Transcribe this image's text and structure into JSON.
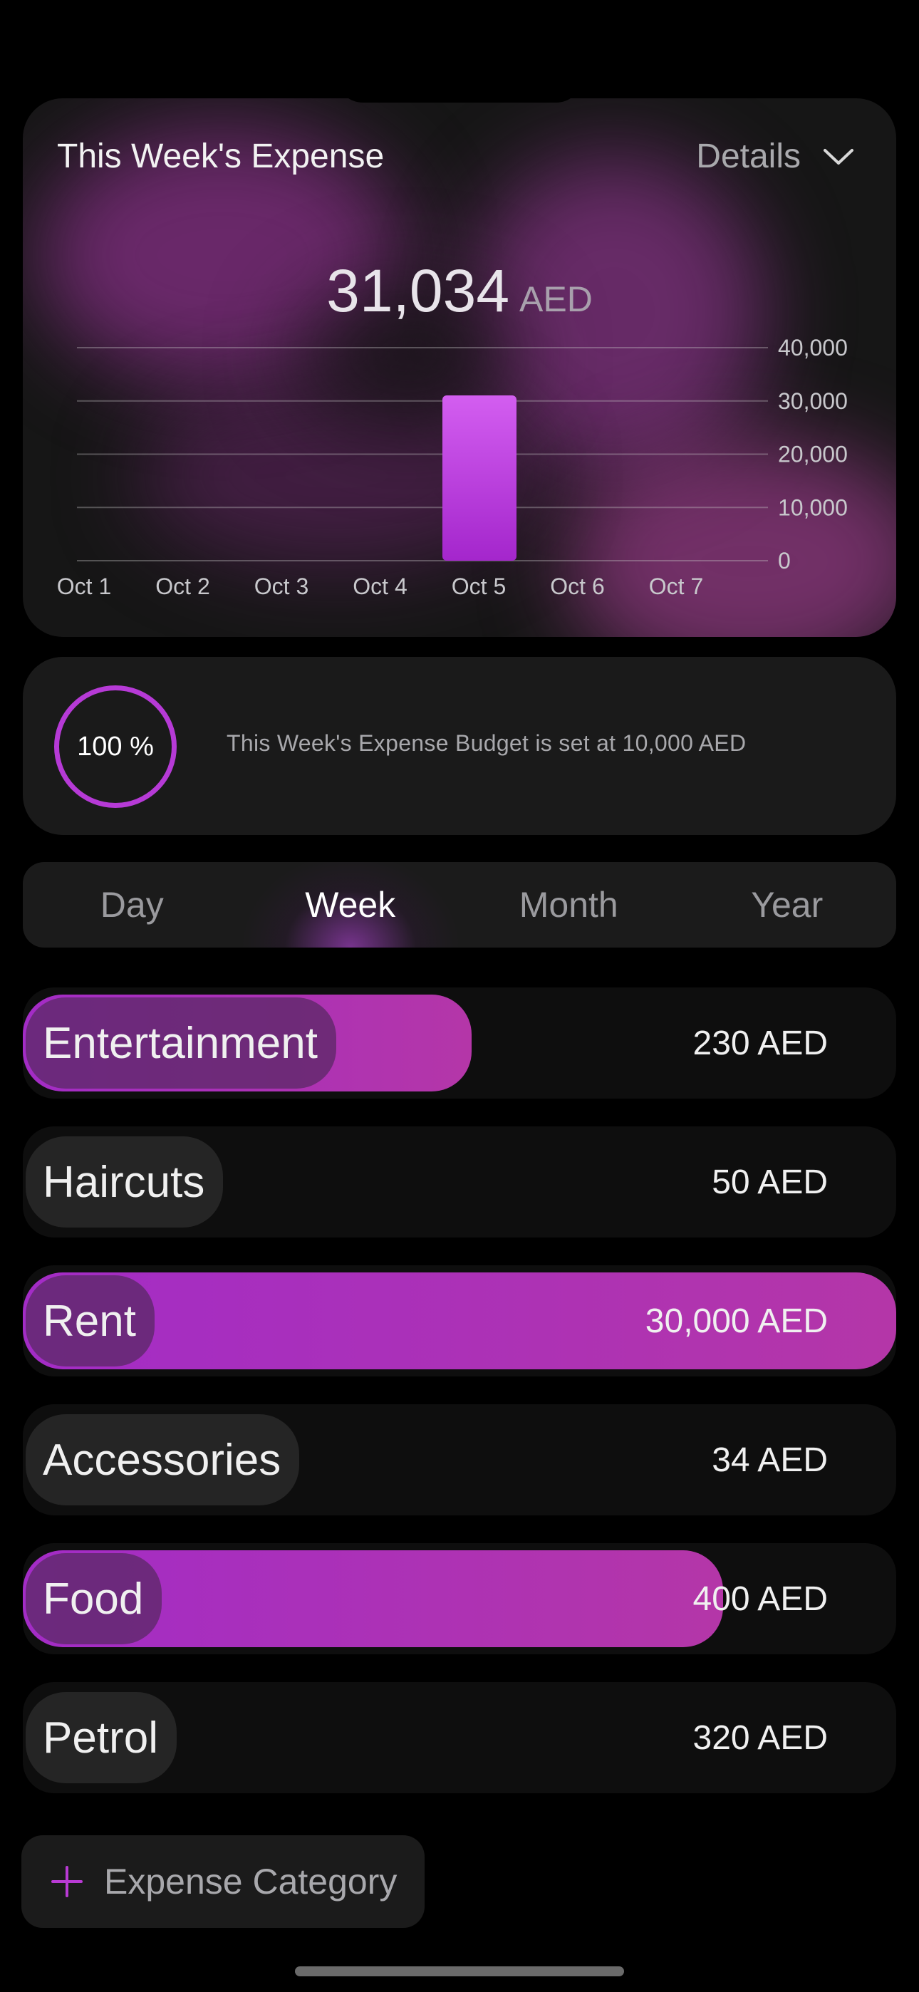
{
  "chart_card": {
    "title": "This Week's Expense",
    "details_label": "Details",
    "total_value": "31,034",
    "total_unit": "AED"
  },
  "chart_data": {
    "type": "bar",
    "categories": [
      "Oct 1",
      "Oct 2",
      "Oct 3",
      "Oct 4",
      "Oct 5",
      "Oct 6",
      "Oct 7"
    ],
    "values": [
      0,
      0,
      0,
      0,
      31034,
      0,
      0
    ],
    "y_ticks": [
      "0",
      "10,000",
      "20,000",
      "30,000",
      "40,000"
    ],
    "ylim": [
      0,
      40000
    ],
    "grid": true,
    "bar_color_top": "#d35ef0",
    "bar_color_bottom": "#a426cc"
  },
  "budget": {
    "percent_label": "100 %",
    "percent": 100,
    "text": "This Week's Expense Budget is set at 10,000 AED",
    "ring_color": "#b63ad6"
  },
  "periods": {
    "items": [
      "Day",
      "Week",
      "Month",
      "Year"
    ],
    "selected": "Week"
  },
  "categories": [
    {
      "name": "Entertainment",
      "amount": "230 AED",
      "fill_fraction": 0.514
    },
    {
      "name": "Haircuts",
      "amount": "50 AED",
      "fill_fraction": 0
    },
    {
      "name": "Rent",
      "amount": "30,000 AED",
      "fill_fraction": 1.0
    },
    {
      "name": "Accessories",
      "amount": "34 AED",
      "fill_fraction": 0
    },
    {
      "name": "Food",
      "amount": "400 AED",
      "fill_fraction": 0.802
    },
    {
      "name": "Petrol",
      "amount": "320 AED",
      "fill_fraction": 0
    }
  ],
  "add_button": {
    "label": "Expense Category",
    "icon": "plus-icon"
  },
  "colors": {
    "accent": "#a32cc6",
    "accent_pink": "#b436a8",
    "background": "#000000"
  }
}
